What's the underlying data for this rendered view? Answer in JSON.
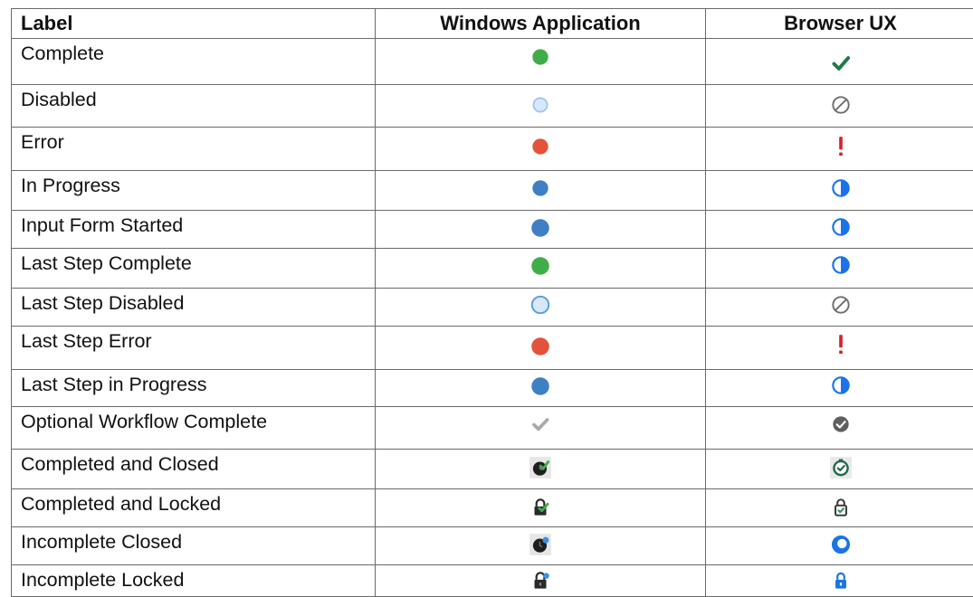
{
  "table": {
    "headers": {
      "label": "Label",
      "windows": "Windows Application",
      "browser": "Browser UX"
    },
    "rows": [
      {
        "label": "Complete",
        "windows_icon": "green-dot",
        "browser_icon": "green-checkmark"
      },
      {
        "label": "Disabled",
        "windows_icon": "light-blue-hollow-dot",
        "browser_icon": "gray-prohibited-circle"
      },
      {
        "label": "Error",
        "windows_icon": "red-dot",
        "browser_icon": "red-exclamation"
      },
      {
        "label": "In Progress",
        "windows_icon": "blue-dot",
        "browser_icon": "blue-half-filled-circle"
      },
      {
        "label": "Input Form Started",
        "windows_icon": "blue-dot",
        "browser_icon": "blue-half-filled-circle"
      },
      {
        "label": "Last Step Complete",
        "windows_icon": "green-dot",
        "browser_icon": "blue-half-filled-circle"
      },
      {
        "label": "Last Step Disabled",
        "windows_icon": "light-blue-hollow-dot",
        "browser_icon": "gray-prohibited-circle"
      },
      {
        "label": "Last Step Error",
        "windows_icon": "red-dot",
        "browser_icon": "red-exclamation"
      },
      {
        "label": "Last Step in Progress",
        "windows_icon": "blue-dot",
        "browser_icon": "blue-half-filled-circle"
      },
      {
        "label": "Optional Workflow Complete",
        "windows_icon": "gray-checkmark",
        "browser_icon": "gray-check-circle"
      },
      {
        "label": "Completed and Closed",
        "windows_icon": "dark-clock-check",
        "browser_icon": "green-clock-check"
      },
      {
        "label": "Completed and Locked",
        "windows_icon": "dark-lock-check",
        "browser_icon": "outline-lock-check"
      },
      {
        "label": "Incomplete Closed",
        "windows_icon": "dark-clock-blue-dot",
        "browser_icon": "blue-ring-circle"
      },
      {
        "label": "Incomplete Locked",
        "windows_icon": "dark-lock-blue-dot",
        "browser_icon": "blue-lock"
      }
    ]
  },
  "colors": {
    "green": "#3fae49",
    "check_green": "#1f7a4a",
    "red": "#e2533a",
    "error_red": "#d8202a",
    "blue": "#3f7fc4",
    "browser_blue": "#1a73e8",
    "light_blue_fill": "#d7e8fb",
    "light_blue_stroke": "#9cc3ee",
    "gray": "#6f6f6f",
    "dark": "#2a2a2a"
  }
}
